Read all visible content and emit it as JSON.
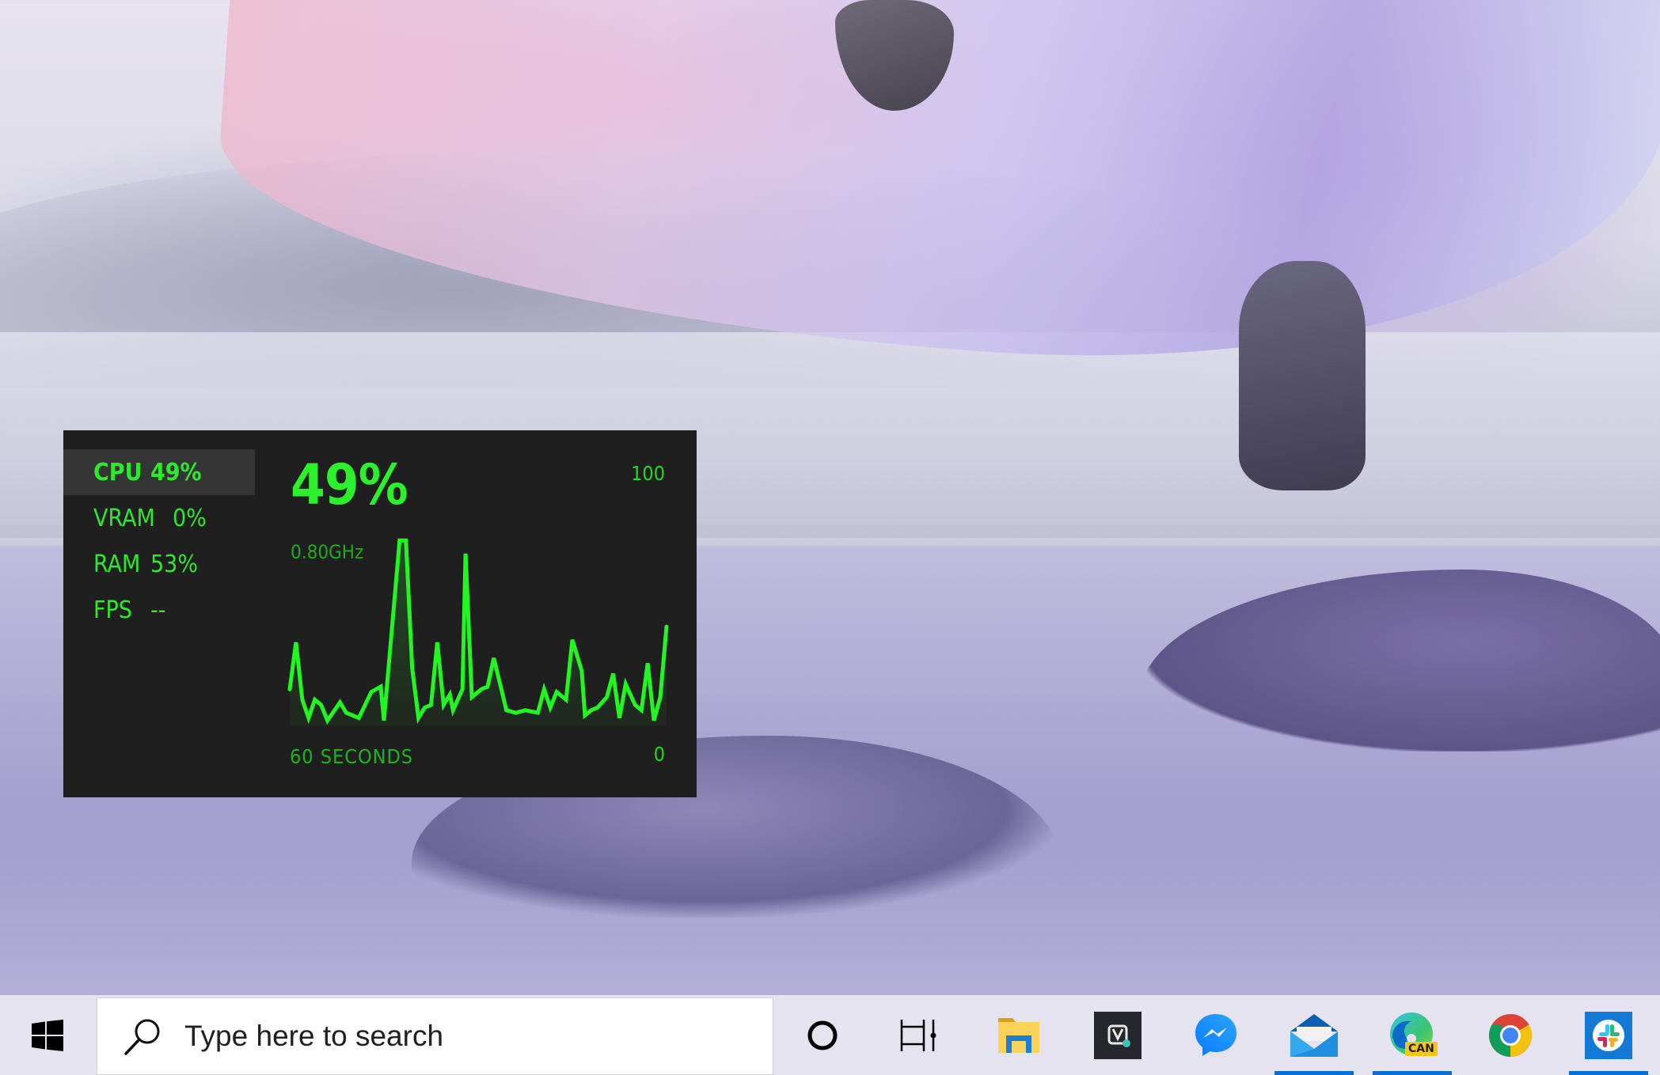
{
  "desktop": {
    "wallpaper": "lakeside-landscape-with-iridescent-ribbon"
  },
  "performance_widget": {
    "accent_color": "#2ee82e",
    "metrics": [
      {
        "label": "CPU",
        "value": "49%",
        "active": true
      },
      {
        "label": "VRAM",
        "value": "0%",
        "active": false
      },
      {
        "label": "RAM",
        "value": "53%",
        "active": false
      },
      {
        "label": "FPS",
        "value": "--",
        "active": false
      }
    ],
    "main_value": "49%",
    "frequency": "0.80GHz",
    "axis_max_label": "100",
    "axis_min_label": "0",
    "duration_label": "60 SECONDS"
  },
  "chart_data": {
    "type": "line",
    "title": "CPU",
    "xlabel": "60 SECONDS",
    "ylabel": "",
    "xlim": [
      0,
      60
    ],
    "ylim": [
      0,
      100
    ],
    "grid": false,
    "series": [
      {
        "name": "CPU usage (%)",
        "x": [
          0,
          1,
          2,
          3,
          4,
          5,
          6,
          8,
          9,
          11,
          13,
          14.5,
          15,
          17.5,
          18.5,
          19.5,
          20.5,
          21.5,
          22.5,
          23.5,
          24.5,
          25.5,
          26,
          27.5,
          28,
          29,
          30.5,
          31.5,
          32.5,
          34.5,
          36,
          37.5,
          39.5,
          40.5,
          41.5,
          42.5,
          44,
          45,
          46.5,
          47,
          48,
          49,
          50.5,
          51.5,
          52.5,
          53.5,
          55,
          56,
          57,
          58,
          59,
          60
        ],
        "values": [
          22,
          40,
          18,
          11,
          18,
          16,
          10,
          17,
          13,
          11,
          21,
          23,
          10,
          79,
          79,
          30,
          11,
          15,
          16,
          40,
          16,
          20,
          14,
          22,
          74,
          19,
          22,
          23,
          34,
          14,
          13,
          14,
          13,
          22,
          15,
          21,
          18,
          41,
          29,
          12,
          14,
          15,
          19,
          28,
          11,
          24,
          16,
          14,
          32,
          10,
          19,
          46,
          49
        ]
      }
    ]
  },
  "taskbar": {
    "start_label": "Start",
    "search": {
      "placeholder": "Type here to search",
      "value": ""
    },
    "items": [
      {
        "name": "Cortana",
        "icon": "cortana-circle-icon",
        "running": false
      },
      {
        "name": "Task View",
        "icon": "task-view-icon",
        "running": false
      },
      {
        "name": "File Explorer",
        "icon": "folder-icon",
        "running": false
      },
      {
        "name": "App",
        "icon": "app-logo-icon",
        "running": false
      },
      {
        "name": "Messenger",
        "icon": "messenger-icon",
        "running": false
      },
      {
        "name": "Mail",
        "icon": "mail-icon",
        "running": true
      },
      {
        "name": "Microsoft Edge Canary",
        "icon": "edge-canary-icon",
        "badge": "CAN",
        "running": true
      },
      {
        "name": "Google Chrome",
        "icon": "chrome-icon",
        "running": false
      },
      {
        "name": "Slack",
        "icon": "slack-icon",
        "running": true
      }
    ],
    "indicator_color": "#0b6fd0"
  }
}
